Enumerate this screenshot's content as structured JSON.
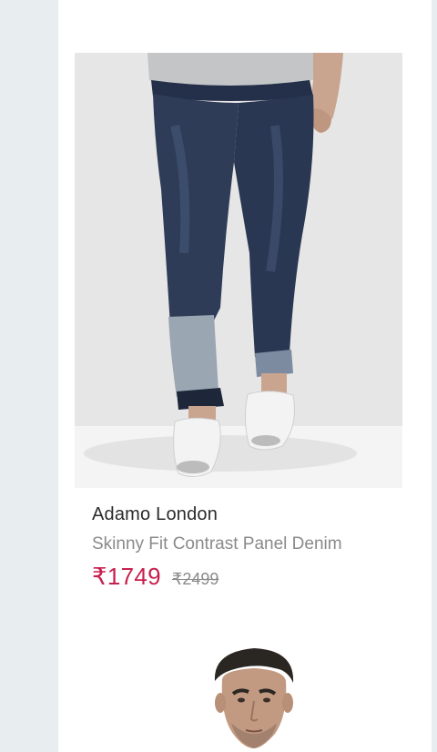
{
  "product": {
    "brand": "Adamo London",
    "title": "Skinny Fit Contrast Panel Denim",
    "price_current": "₹1749",
    "price_original": "₹2499",
    "image_icon": "product-photo-jeans"
  },
  "next_product": {
    "image_icon": "product-photo-model"
  },
  "colors": {
    "sale_price": "#c8204e",
    "muted_text": "#8a8a8a",
    "side_strip": "#e8edf0"
  }
}
